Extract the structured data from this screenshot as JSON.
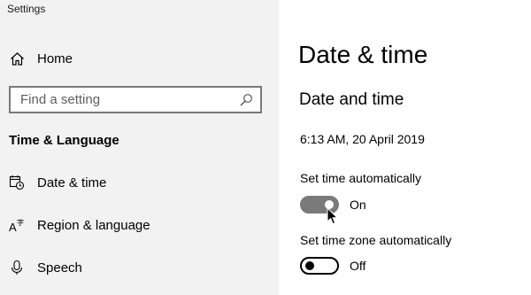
{
  "window": {
    "title": "Settings"
  },
  "sidebar": {
    "home_label": "Home",
    "search": {
      "placeholder": "Find a setting",
      "value": ""
    },
    "section_heading": "Time & Language",
    "items": [
      {
        "label": "Date & time",
        "icon": "date-time-icon"
      },
      {
        "label": "Region & language",
        "icon": "region-language-icon"
      },
      {
        "label": "Speech",
        "icon": "microphone-icon"
      }
    ]
  },
  "main": {
    "page_title": "Date & time",
    "subheading": "Date and time",
    "current_datetime": "6:13 AM, 20 April 2019",
    "settings": [
      {
        "label": "Set time automatically",
        "state": "On",
        "enabled": true
      },
      {
        "label": "Set time zone automatically",
        "state": "Off",
        "enabled": false
      }
    ]
  },
  "colors": {
    "sidebar_bg": "#f2f2f2",
    "main_bg": "#ffffff",
    "toggle_on": "#7a7a7a",
    "toggle_off_border": "#000000"
  }
}
